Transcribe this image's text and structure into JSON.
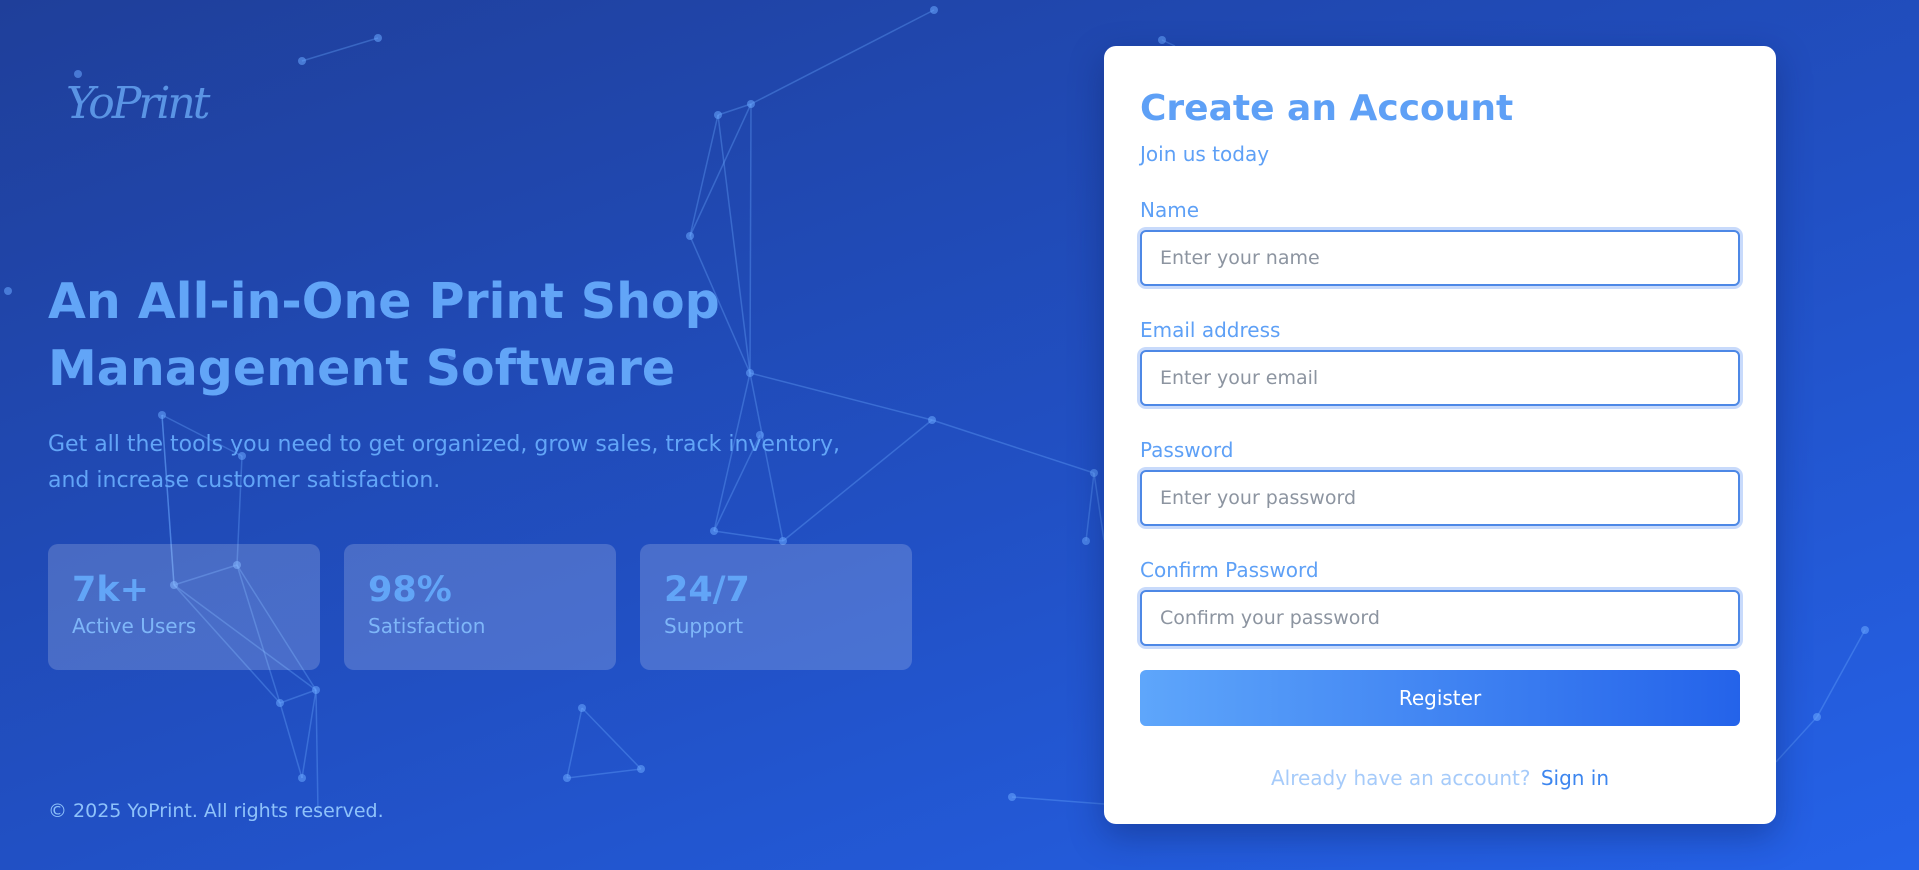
{
  "brand": {
    "logo_text": "YoPrint"
  },
  "hero": {
    "title": "An All-in-One Print Shop Management Software",
    "subtitle": "Get all the tools you need to get organized, grow sales, track inventory, and increase customer satisfaction."
  },
  "stats": [
    {
      "value": "7k+",
      "label": "Active Users"
    },
    {
      "value": "98%",
      "label": "Satisfaction"
    },
    {
      "value": "24/7",
      "label": "Support"
    }
  ],
  "footer": {
    "copyright": "© 2025 YoPrint. All rights reserved."
  },
  "form": {
    "title": "Create an Account",
    "subtitle": "Join us today",
    "fields": [
      {
        "label": "Name",
        "placeholder": "Enter your name",
        "value": ""
      },
      {
        "label": "Email address",
        "placeholder": "Enter your email",
        "value": ""
      },
      {
        "label": "Password",
        "placeholder": "Enter your password",
        "value": ""
      },
      {
        "label": "Confirm Password",
        "placeholder": "Confirm your password",
        "value": ""
      }
    ],
    "submit_label": "Register",
    "signin_prompt": "Already have an account?",
    "signin_link": "Sign in"
  },
  "colors": {
    "accent": "#5ea0f6",
    "button_gradient_start": "#5ea6fb",
    "button_gradient_end": "#2463ea",
    "background_start": "#1f3f9a",
    "background_end": "#2562e8"
  }
}
